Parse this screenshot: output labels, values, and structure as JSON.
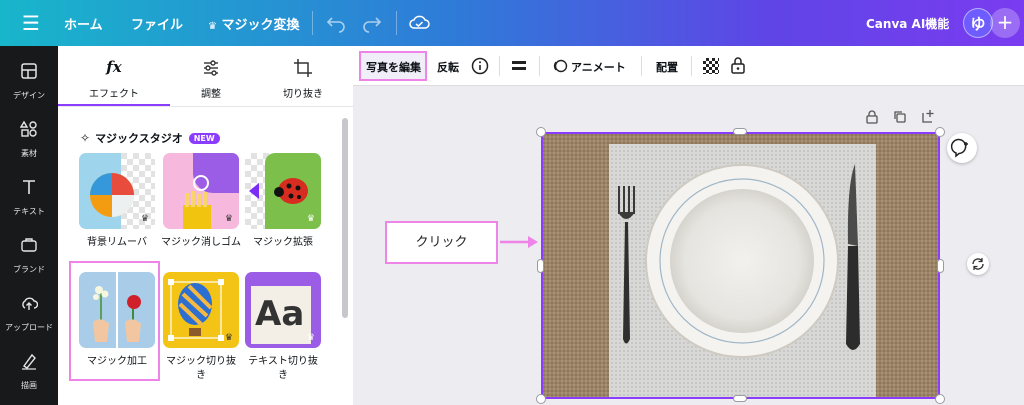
{
  "topbar": {
    "home": "ホーム",
    "file": "ファイル",
    "magic": "マジック変換",
    "canva_ai": "Canva AI機能",
    "avatar_initial": "ゆ",
    "plus": "+"
  },
  "rail": {
    "items": [
      {
        "label": "デザイン",
        "icon": "layout-icon"
      },
      {
        "label": "素材",
        "icon": "shapes-icon"
      },
      {
        "label": "テキスト",
        "icon": "text-icon"
      },
      {
        "label": "ブランド",
        "icon": "brand-icon"
      },
      {
        "label": "アップロード",
        "icon": "upload-icon"
      },
      {
        "label": "描画",
        "icon": "draw-icon"
      }
    ]
  },
  "panel": {
    "tabs": [
      {
        "label": "エフェクト",
        "icon": "fx"
      },
      {
        "label": "調整",
        "icon": "sliders-icon"
      },
      {
        "label": "切り抜き",
        "icon": "crop-icon"
      }
    ],
    "section_title": "マジックスタジオ",
    "new_badge": "NEW",
    "cards": [
      {
        "label": "背景リムーバ"
      },
      {
        "label": "マジック消しゴム"
      },
      {
        "label": "マジック拡張"
      },
      {
        "label": "マジック加工"
      },
      {
        "label": "マジック切り抜\nき"
      },
      {
        "label": "テキスト切り抜\nき"
      }
    ],
    "text_tile": "Aa"
  },
  "toolbar": {
    "edit_photo": "写真を編集",
    "flip": "反転",
    "animate": "アニメート",
    "position": "配置"
  },
  "callout": {
    "text": "クリック"
  },
  "colors": {
    "accent": "#8b3dff",
    "highlight": "#ee84e8"
  }
}
